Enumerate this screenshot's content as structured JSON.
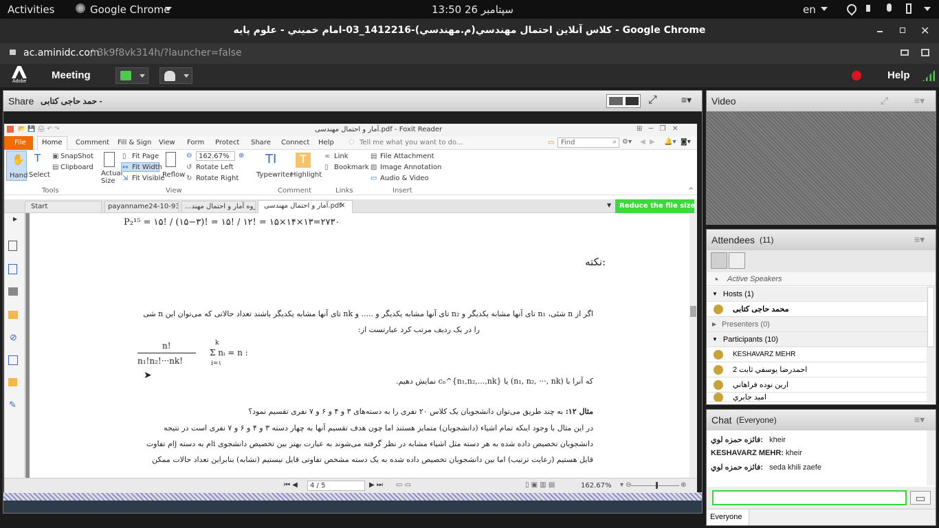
{
  "topbar": {
    "activities": "Activities",
    "app": "Google Chrome",
    "clock": "13:50  26 سپتامبر",
    "lang": "en"
  },
  "window": {
    "title": "كلاس آنلاين احتمال مهندسي(م.مهندسي)-1412216_03-امام خميني - علوم پايه - Google Chrome"
  },
  "url": {
    "host": "ac.aminidc.com",
    "path": "/r3k9f8vk314h/?launcher=false"
  },
  "adobe": {
    "logo": "Adobe",
    "meeting": "Meeting",
    "help": "Help"
  },
  "share": {
    "title": "Share",
    "presenter": "حمد حاجی کتابی -"
  },
  "foxit": {
    "doc_title": "آمار و احتمال مهندسی.pdf - Foxit Reader",
    "menus": [
      "File",
      "Home",
      "Comment",
      "Fill & Sign",
      "View",
      "Form",
      "Protect",
      "Share",
      "Connect",
      "Help"
    ],
    "tellme": "Tell me what you want to do...",
    "find_placeholder": "Find",
    "tools": {
      "hand": "Hand",
      "select": "Select",
      "snapshot": "SnapShot",
      "clipboard": "Clipboard",
      "group": "Tools"
    },
    "actual": "Actual Size",
    "view": {
      "fit_page": "Fit Page",
      "fit_width": "Fit Width",
      "fit_visible": "Fit Visible",
      "reflow": "Reflow",
      "zoom": "162.67%",
      "rotate_left": "Rotate Left",
      "rotate_right": "Rotate Right",
      "group": "View"
    },
    "comment": {
      "typewriter": "Typewriter",
      "highlight": "Highlight",
      "group": "Comment"
    },
    "links": {
      "link": "Link",
      "bookmark": "Bookmark",
      "group": "Links"
    },
    "insert": {
      "file_attachment": "File Attachment",
      "image_annotation": "Image Annotation",
      "audio_video": "Audio & Video",
      "group": "Insert"
    },
    "tabs": [
      "Start",
      "payanname24-10-93....",
      "...جزوه آمار و احتمال مهند",
      "آمار و احتمال مهندسی.pdf"
    ],
    "reduce": "Reduce the file size",
    "page": "4 / 5",
    "zoom_status": "162.67%",
    "content": {
      "formula1": "P₂¹⁵ = ۱۵! / (۱۵−۳)! = ۱۵! / ۱۲! = ۱۵×۱۴×۱۳=۲۷۳۰",
      "note_title": "نکته:",
      "para1": "اگر از n شئی، n₁ تای آنها مشابه یکدیگر و n₂ تای آنها مشابه یکدیگر و ..... و nk تای آنها مشابه یکدیگر باشند تعداد حالاتی که می‌توان این n شی",
      "para1b": "را در یک ردیف مرتب کرد عبارتست از:",
      "formula2_num": "n!",
      "formula2_den": "n₁!n₂!···nk!",
      "formula2_sum": "Σ nᵢ = n :",
      "sum_top": "k",
      "sum_bot": "i=۱",
      "para2": "که آنرا با (n₁, n₂, ···, nk) یا cₙ^{n₁,n₂,...,nk} نمایش دهیم.",
      "example_title": "مثال ۱۲:",
      "example_q": "به چند طریق می‌توان دانشجویان یک کلاس ۲۰ نفری را به دسته‌های ۳ و ۴ و ۶ و ۷ نفری تقسیم نمود؟",
      "ex1": "در این مثال با وجود اینکه تمام اشیاء (دانشجویان) متمایز هستند اما چون هدف تقسیم آنها به چهار دسته ۳ و ۴ و ۶ و ۷ نفری است در نتیجه",
      "ex2": "دانشجویان تخصیص داده شده به هر دسته مثل اشیاء مشابه در نظر گرفته می‌شوند به عبارت بهتر بین تخصیص دانشجوی iام به دسته jام تفاوت",
      "ex3": "قایل هستیم (رعایت ترتیب) اما بین دانشجویان تخصیص داده شده به یک دسته مشخص تفاوتی قایل نیستیم (تشابه) بنابراین تعداد حالات ممکن"
    }
  },
  "video": {
    "title": "Video"
  },
  "attendees": {
    "title": "Attendees",
    "count": "(11)",
    "active": "Active Speakers",
    "hosts": "Hosts (1)",
    "host1": "محمد حاجی کتابی",
    "presenters": "Presenters (0)",
    "participants": "Participants (10)",
    "p1": "KESHAVARZ MEHR",
    "p2": "احمدرضا يوسفي ثابت 2",
    "p3": "ارين نوده فراهاني",
    "p4": "اميد جابري"
  },
  "chat": {
    "title": "Chat",
    "scope": "(Everyone)",
    "m1_name": "فائزه حمزه لوي:",
    "m1_text": "kheir",
    "m2_name": "KESHAVARZ MEHR:",
    "m2_text": "kheir",
    "m3_name": "فائزه حمزه لوي:",
    "m3_text": "seda khili zaefe",
    "target": "Everyone"
  }
}
